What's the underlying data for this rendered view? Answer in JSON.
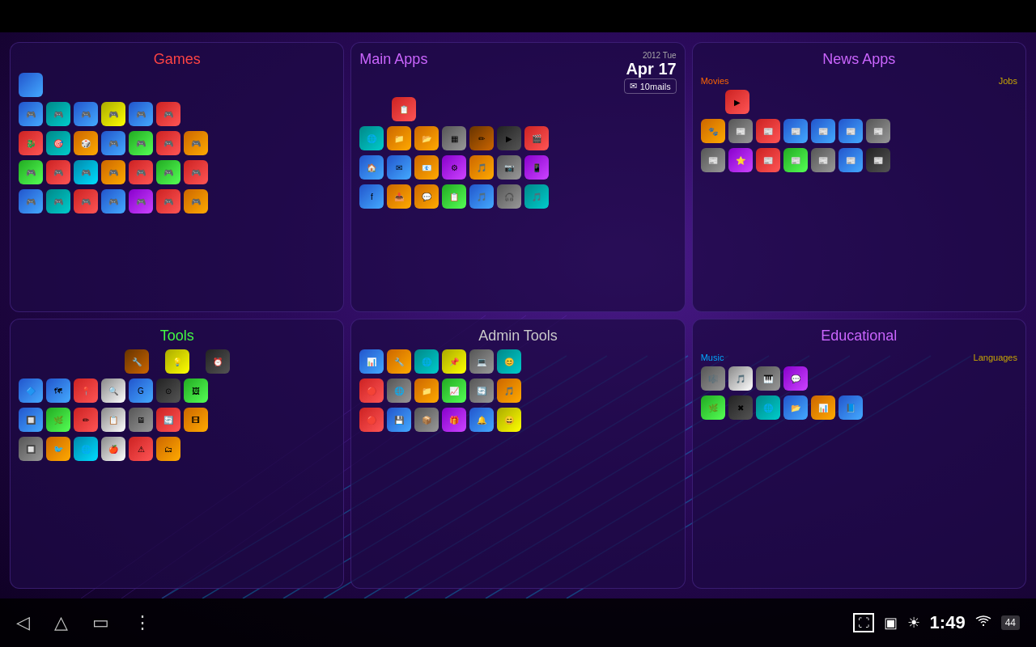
{
  "topBar": {},
  "bottomBar": {
    "back_icon": "◁",
    "home_icon": "△",
    "recents_icon": "▭",
    "menu_icon": "⋮",
    "fullscreen_icon": "⛶",
    "sd_icon": "▣",
    "brightness_icon": "☀",
    "time": "1:49",
    "wifi_icon": "WiFi",
    "battery_icon": "44"
  },
  "panels": {
    "games": {
      "title": "Games",
      "title_class": "games-title",
      "icons": [
        {
          "color": "ic-blue"
        },
        {
          "color": "ic-transparent"
        },
        {
          "color": "ic-transparent"
        },
        {
          "color": "ic-transparent"
        },
        {
          "color": "ic-transparent"
        },
        {
          "color": "ic-blue"
        },
        {
          "color": "ic-red"
        },
        {
          "color": "ic-red"
        },
        {
          "color": "ic-green"
        },
        {
          "color": "ic-transparent"
        },
        {
          "color": "ic-orange"
        },
        {
          "color": "ic-transparent"
        },
        {
          "color": "ic-orange"
        },
        {
          "color": "ic-transparent"
        },
        {
          "color": "ic-transparent"
        },
        {
          "color": "ic-orange"
        },
        {
          "color": "ic-transparent"
        },
        {
          "color": "ic-transparent"
        },
        {
          "color": "ic-transparent"
        },
        {
          "color": "ic-transparent"
        },
        {
          "color": "ic-transparent"
        },
        {
          "color": "ic-green"
        },
        {
          "color": "ic-red"
        },
        {
          "color": "ic-cyan"
        },
        {
          "color": "ic-orange"
        },
        {
          "color": "ic-red"
        },
        {
          "color": "ic-green"
        },
        {
          "color": "ic-red"
        },
        {
          "color": "ic-blue"
        },
        {
          "color": "ic-teal"
        },
        {
          "color": "ic-red"
        },
        {
          "color": "ic-blue"
        },
        {
          "color": "ic-purple"
        },
        {
          "color": "ic-red"
        },
        {
          "color": "ic-orange"
        }
      ]
    },
    "mainApps": {
      "title": "Main Apps",
      "date_day": "Tue",
      "date_num": "Apr 17",
      "mail_count": "10mails",
      "icons": [
        {
          "color": "ic-transparent"
        },
        {
          "color": "ic-transparent"
        },
        {
          "color": "ic-transparent"
        },
        {
          "color": "ic-transparent"
        },
        {
          "color": "ic-transparent"
        },
        {
          "color": "ic-transparent"
        },
        {
          "color": "ic-red"
        },
        {
          "color": "ic-teal"
        },
        {
          "color": "ic-orange"
        },
        {
          "color": "ic-orange"
        },
        {
          "color": "ic-gray"
        },
        {
          "color": "ic-brown"
        },
        {
          "color": "ic-dark"
        },
        {
          "color": "ic-red"
        },
        {
          "color": "ic-blue"
        },
        {
          "color": "ic-blue"
        },
        {
          "color": "ic-orange"
        },
        {
          "color": "ic-purple"
        },
        {
          "color": "ic-orange"
        },
        {
          "color": "ic-gray"
        },
        {
          "color": "ic-purple"
        },
        {
          "color": "ic-blue"
        },
        {
          "color": "ic-orange"
        },
        {
          "color": "ic-orange"
        },
        {
          "color": "ic-green"
        },
        {
          "color": "ic-blue"
        },
        {
          "color": "ic-gray"
        },
        {
          "color": "ic-teal"
        },
        {
          "color": "ic-purple"
        },
        {
          "color": "ic-red"
        },
        {
          "color": "ic-blue"
        },
        {
          "color": "ic-orange"
        },
        {
          "color": "ic-blue"
        },
        {
          "color": "ic-gray"
        },
        {
          "color": "ic-teal"
        }
      ]
    },
    "newsApps": {
      "title": "News Apps",
      "sub_movies": "Movies",
      "sub_jobs": "Jobs",
      "icons_movies": [
        {
          "color": "ic-red"
        },
        {
          "color": "ic-transparent"
        },
        {
          "color": "ic-transparent"
        },
        {
          "color": "ic-transparent"
        },
        {
          "color": "ic-transparent"
        },
        {
          "color": "ic-transparent"
        },
        {
          "color": "ic-transparent"
        }
      ],
      "icons_row2": [
        {
          "color": "ic-orange"
        },
        {
          "color": "ic-gray"
        },
        {
          "color": "ic-red"
        },
        {
          "color": "ic-blue"
        },
        {
          "color": "ic-blue"
        },
        {
          "color": "ic-blue"
        },
        {
          "color": "ic-transparent"
        }
      ],
      "icons_row3": [
        {
          "color": "ic-gray"
        },
        {
          "color": "ic-purple"
        },
        {
          "color": "ic-red"
        },
        {
          "color": "ic-green"
        },
        {
          "color": "ic-gray"
        },
        {
          "color": "ic-blue"
        },
        {
          "color": "ic-dark"
        }
      ]
    },
    "tools": {
      "title": "Tools",
      "icons": [
        {
          "color": "ic-transparent"
        },
        {
          "color": "ic-transparent"
        },
        {
          "color": "ic-brown"
        },
        {
          "color": "ic-transparent"
        },
        {
          "color": "ic-yellow"
        },
        {
          "color": "ic-transparent"
        },
        {
          "color": "ic-transparent"
        },
        {
          "color": "ic-transparent"
        },
        {
          "color": "ic-dark"
        },
        {
          "color": "ic-blue"
        },
        {
          "color": "ic-blue"
        },
        {
          "color": "ic-red"
        },
        {
          "color": "ic-white"
        },
        {
          "color": "ic-blue"
        },
        {
          "color": "ic-dark"
        },
        {
          "color": "ic-green"
        },
        {
          "color": "ic-transparent"
        },
        {
          "color": "ic-transparent"
        },
        {
          "color": "ic-blue"
        },
        {
          "color": "ic-green"
        },
        {
          "color": "ic-red"
        },
        {
          "color": "ic-white"
        },
        {
          "color": "ic-gray"
        },
        {
          "color": "ic-red"
        },
        {
          "color": "ic-transparent"
        },
        {
          "color": "ic-transparent"
        },
        {
          "color": "ic-transparent"
        },
        {
          "color": "ic-gray"
        },
        {
          "color": "ic-green"
        },
        {
          "color": "ic-transparent"
        },
        {
          "color": "ic-white"
        },
        {
          "color": "ic-transparent"
        },
        {
          "color": "ic-transparent"
        },
        {
          "color": "ic-transparent"
        },
        {
          "color": "ic-transparent"
        },
        {
          "color": "ic-transparent"
        },
        {
          "color": "ic-dark"
        },
        {
          "color": "ic-orange"
        },
        {
          "color": "ic-transparent"
        },
        {
          "color": "ic-transparent"
        },
        {
          "color": "ic-red"
        },
        {
          "color": "ic-transparent"
        },
        {
          "color": "ic-transparent"
        },
        {
          "color": "ic-transparent"
        },
        {
          "color": "ic-transparent"
        }
      ]
    },
    "adminTools": {
      "title": "Admin Tools",
      "icons": [
        {
          "color": "ic-blue"
        },
        {
          "color": "ic-orange"
        },
        {
          "color": "ic-teal"
        },
        {
          "color": "ic-yellow"
        },
        {
          "color": "ic-gray"
        },
        {
          "color": "ic-teal"
        },
        {
          "color": "ic-red"
        },
        {
          "color": "ic-gray"
        },
        {
          "color": "ic-orange"
        },
        {
          "color": "ic-green"
        },
        {
          "color": "ic-gray"
        },
        {
          "color": "ic-orange"
        },
        {
          "color": "ic-red"
        },
        {
          "color": "ic-blue"
        },
        {
          "color": "ic-gray"
        },
        {
          "color": "ic-purple"
        },
        {
          "color": "ic-blue"
        },
        {
          "color": "ic-yellow"
        }
      ]
    },
    "educational": {
      "title": "Educational",
      "sub_music": "Music",
      "sub_languages": "Languages",
      "icons_music": [
        {
          "color": "ic-gray"
        },
        {
          "color": "ic-white"
        },
        {
          "color": "ic-gray"
        },
        {
          "color": "ic-purple"
        }
      ],
      "icons_lang": [
        {
          "color": "ic-transparent"
        },
        {
          "color": "ic-transparent"
        },
        {
          "color": "ic-transparent"
        },
        {
          "color": "ic-transparent"
        },
        {
          "color": "ic-transparent"
        },
        {
          "color": "ic-transparent"
        }
      ],
      "icons_row2": [
        {
          "color": "ic-green"
        },
        {
          "color": "ic-dark"
        },
        {
          "color": "ic-teal"
        },
        {
          "color": "ic-blue"
        },
        {
          "color": "ic-orange"
        },
        {
          "color": "ic-blue"
        }
      ]
    }
  }
}
